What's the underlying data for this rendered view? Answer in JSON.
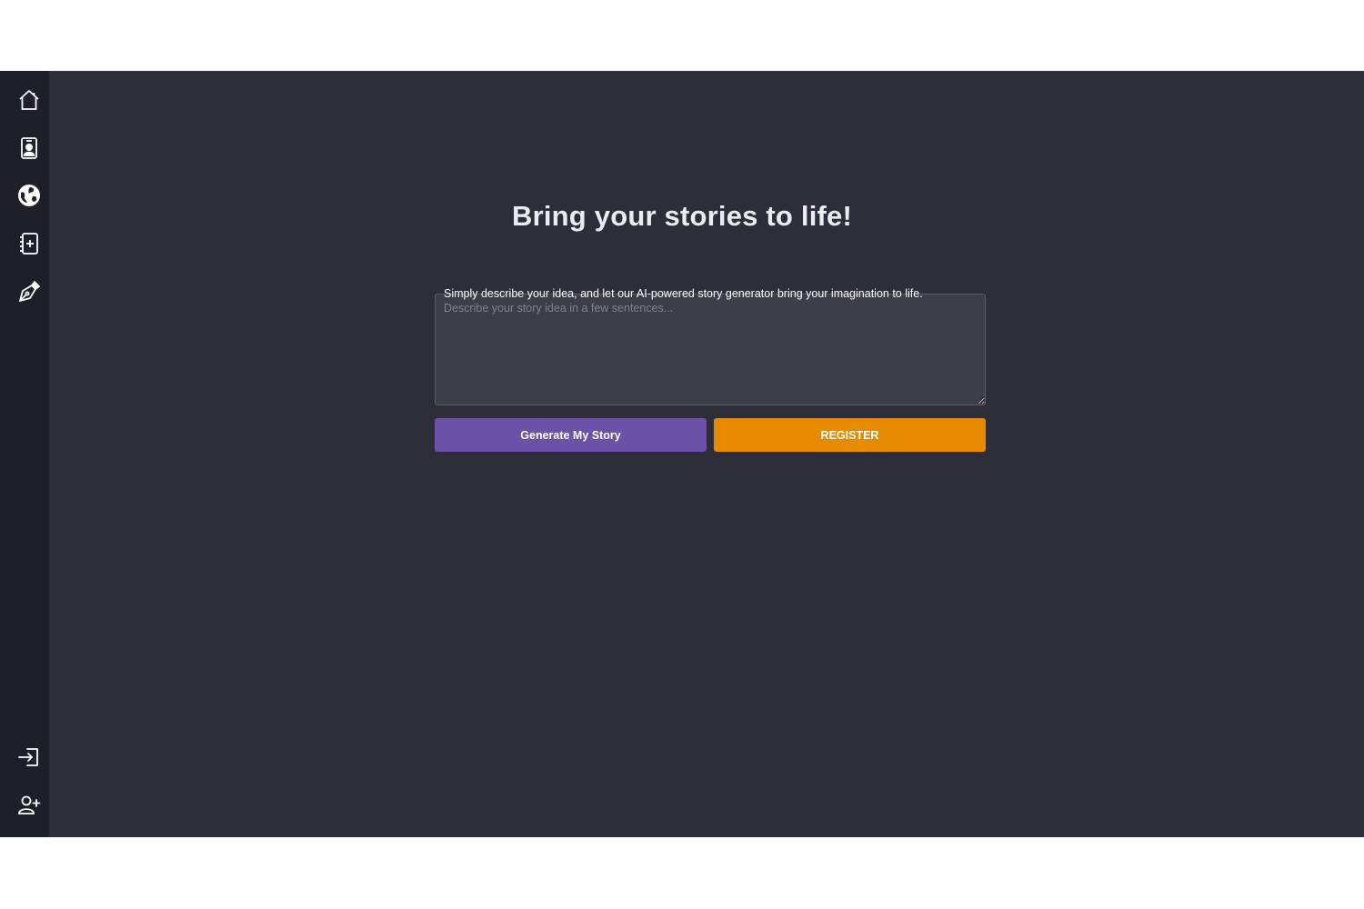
{
  "sidebar": {
    "top_items": [
      {
        "name": "home",
        "icon": "home-icon"
      },
      {
        "name": "profile",
        "icon": "profile-card-icon"
      },
      {
        "name": "explore",
        "icon": "globe-icon"
      },
      {
        "name": "new-story",
        "icon": "add-notebook-icon"
      },
      {
        "name": "write",
        "icon": "pen-nib-icon"
      }
    ],
    "bottom_items": [
      {
        "name": "login",
        "icon": "login-icon"
      },
      {
        "name": "register",
        "icon": "add-user-icon"
      }
    ]
  },
  "main": {
    "title": "Bring your stories to life!",
    "prompt_label": "Simply describe your idea, and let our AI-powered story generator bring your imagination to life.",
    "idea_input": {
      "value": "",
      "placeholder": "Describe your story idea in a few sentences..."
    },
    "generate_button": "Generate My Story",
    "register_button": "REGISTER"
  },
  "colors": {
    "background": "#2d2e3a",
    "sidebar": "#1e1f28",
    "primary": "#6b51a8",
    "accent": "#e68a00"
  }
}
